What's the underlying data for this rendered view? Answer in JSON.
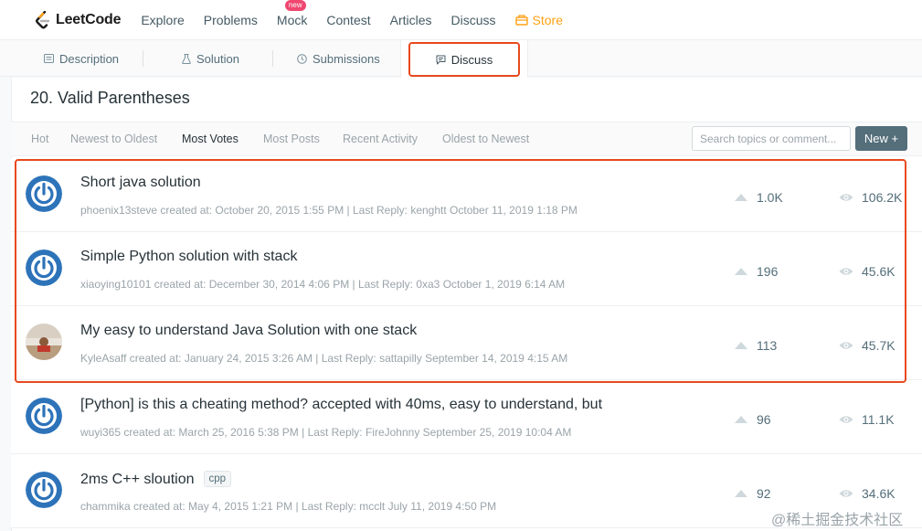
{
  "brand": {
    "name": "LeetCode"
  },
  "nav": {
    "items": [
      "Explore",
      "Problems",
      "Mock",
      "Contest",
      "Articles",
      "Discuss"
    ],
    "new_badge": "new",
    "store": "Store"
  },
  "tabs": {
    "description": "Description",
    "solution": "Solution",
    "submissions": "Submissions",
    "discuss": "Discuss"
  },
  "page": {
    "title": "20. Valid Parentheses"
  },
  "sort": {
    "options": [
      "Hot",
      "Newest to Oldest",
      "Most Votes",
      "Most Posts",
      "Recent Activity",
      "Oldest to Newest"
    ],
    "active": "Most Votes"
  },
  "search": {
    "placeholder": "Search topics or comment..."
  },
  "new_button": "New +",
  "colors": {
    "accent": "#ffa116",
    "highlight": "#e8491d",
    "avatar_blue": "#2d73b9"
  },
  "posts": [
    {
      "title": "Short java solution",
      "tag": "",
      "meta": "phoenix13steve created at: October 20, 2015 1:55 PM | Last Reply: kenghtt October 11, 2019 1:18 PM",
      "votes": "1.0K",
      "views": "106.2K",
      "avatar": "power-icon"
    },
    {
      "title": "Simple Python solution with stack",
      "tag": "",
      "meta": "xiaoying10101 created at: December 30, 2014 4:06 PM | Last Reply: 0xa3 October 1, 2019 6:14 AM",
      "votes": "196",
      "views": "45.6K",
      "avatar": "power-icon"
    },
    {
      "title": "My easy to understand Java Solution with one stack",
      "tag": "",
      "meta": "KyleAsaff created at: January 24, 2015 3:26 AM | Last Reply: sattapilly September 14, 2019 4:15 AM",
      "votes": "113",
      "views": "45.7K",
      "avatar": "photo"
    },
    {
      "title": "[Python] is this a cheating method? accepted with 40ms, easy to understand, but",
      "tag": "",
      "meta": "wuyi365 created at: March 25, 2016 5:38 PM | Last Reply: FireJohnny September 25, 2019 10:04 AM",
      "votes": "96",
      "views": "11.1K",
      "avatar": "power-icon"
    },
    {
      "title": "2ms C++ sloution",
      "tag": "cpp",
      "meta": "chammika created at: May 4, 2015 1:21 PM | Last Reply: mcclt July 11, 2019 4:50 PM",
      "votes": "92",
      "views": "34.6K",
      "avatar": "power-icon"
    }
  ],
  "watermark": "@稀土掘金技术社区"
}
